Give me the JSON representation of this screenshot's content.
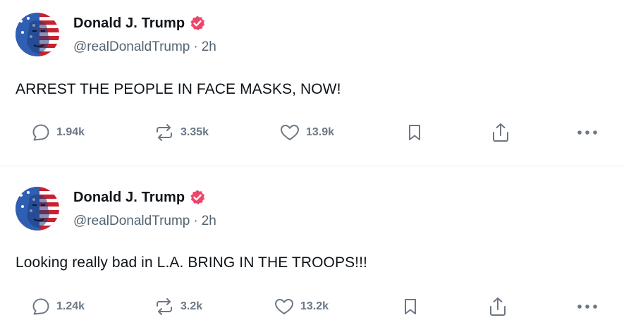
{
  "posts": [
    {
      "author": {
        "display_name": "Donald J. Trump",
        "handle": "@realDonaldTrump",
        "verified": true
      },
      "time_ago": "2h",
      "separator": "·",
      "text": "ARREST THE PEOPLE IN FACE MASKS, NOW!",
      "stats": {
        "replies": "1.94k",
        "reposts": "3.35k",
        "likes": "13.9k"
      }
    },
    {
      "author": {
        "display_name": "Donald J. Trump",
        "handle": "@realDonaldTrump",
        "verified": true
      },
      "time_ago": "2h",
      "separator": "·",
      "text": "Looking really bad in L.A. BRING IN THE TROOPS!!!",
      "stats": {
        "replies": "1.24k",
        "reposts": "3.2k",
        "likes": "13.2k"
      }
    }
  ],
  "icons": {
    "reply": "reply-icon",
    "repost": "repost-icon",
    "like": "heart-icon",
    "bookmark": "bookmark-icon",
    "share": "share-icon",
    "more": "more-icon",
    "verified": "verified-badge-icon"
  },
  "colors": {
    "text_primary": "#0f1419",
    "text_secondary": "#536471",
    "action_gray": "#6b7785",
    "verified_badge": "#f1446b",
    "divider": "#eceef0"
  }
}
